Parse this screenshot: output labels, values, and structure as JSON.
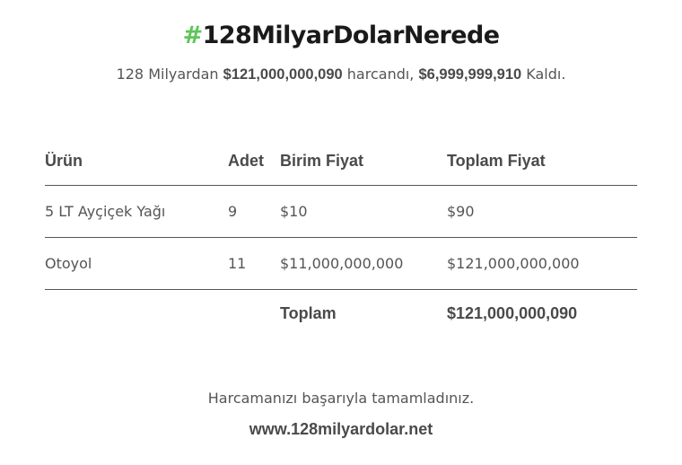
{
  "title": {
    "hash": "#",
    "text": "128MilyarDolarNerede"
  },
  "summary": {
    "prefix": "128 Milyardan ",
    "spent": "$121,000,000,090",
    "middle": " harcandı, ",
    "remaining": "$6,999,999,910",
    "suffix": " Kaldı."
  },
  "table": {
    "headers": {
      "product": "Ürün",
      "quantity": "Adet",
      "unit_price": "Birim Fiyat",
      "total_price": "Toplam Fiyat"
    },
    "rows": [
      {
        "product": "5 LT Ayçiçek Yağı",
        "quantity": "9",
        "unit_price": "$10",
        "total_price": "$90"
      },
      {
        "product": "Otoyol",
        "quantity": "11",
        "unit_price": "$11,000,000,000",
        "total_price": "$121,000,000,000"
      }
    ],
    "total": {
      "label": "Toplam",
      "value": "$121,000,000,090"
    }
  },
  "footer": {
    "message": "Harcamanızı başarıyla tamamladınız.",
    "url": "www.128milyardolar.net"
  },
  "colors": {
    "hash_accent": "#5cc65a",
    "title": "#1a1a1a",
    "text": "#555555"
  }
}
